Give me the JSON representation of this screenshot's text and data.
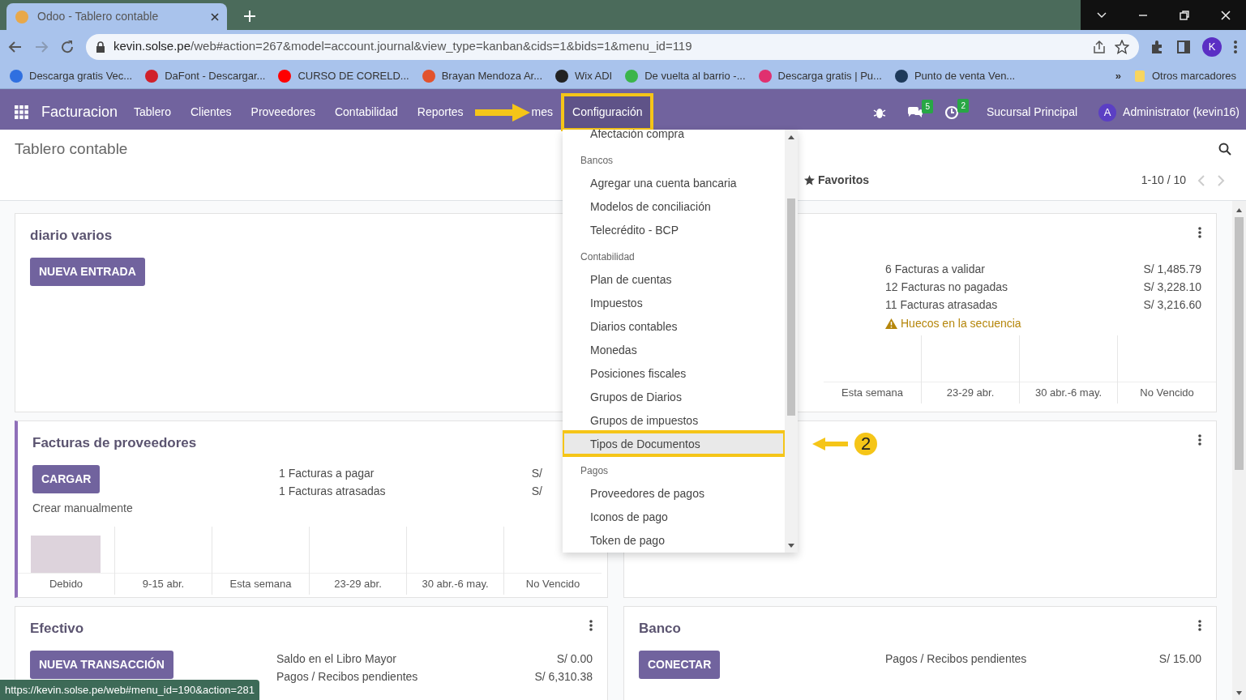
{
  "browser": {
    "tab_title": "Odoo - Tablero contable",
    "url_host": "kevin.solse.pe",
    "url_path": "/web#action=267&model=account.journal&view_type=kanban&cids=1&bids=1&menu_id=119",
    "profile_initial": "K",
    "bookmarks": [
      {
        "label": "Descarga gratis Vec...",
        "color": "#2f6fe0"
      },
      {
        "label": "DaFont - Descargar...",
        "color": "#d0202a"
      },
      {
        "label": "CURSO DE CORELD...",
        "color": "#ff0000"
      },
      {
        "label": "Brayan Mendoza Ar...",
        "color": "#e2532d"
      },
      {
        "label": "Wix ADI",
        "color": "#222222"
      },
      {
        "label": "De vuelta al barrio -...",
        "color": "#3bb54a"
      },
      {
        "label": "Descarga gratis | Pu...",
        "color": "#e0306f"
      },
      {
        "label": "Punto de venta Ven...",
        "color": "#1e3a5a"
      }
    ],
    "more": "»",
    "other_bookmarks": "Otros marcadores",
    "status_url": "https://kevin.solse.pe/web#menu_id=190&action=281"
  },
  "app": {
    "name": "Facturacion",
    "menu": [
      {
        "label": "Tablero",
        "selected": false,
        "outlined": false
      },
      {
        "label": "Clientes",
        "selected": false,
        "outlined": false
      },
      {
        "label": "Proveedores",
        "selected": false,
        "outlined": false
      },
      {
        "label": "Contabilidad",
        "selected": false,
        "outlined": false
      },
      {
        "label": "Reportes",
        "selected": false,
        "outlined": false
      },
      {
        "label": "mes",
        "selected": false,
        "outlined": false
      },
      {
        "label": "Configuración",
        "selected": true,
        "outlined": true
      }
    ],
    "messages_badge": "5",
    "activities_badge": "2",
    "company": "Sucursal Principal",
    "user_initial": "A",
    "user": "Administrator (kevin16)"
  },
  "dropdown": [
    {
      "kind": "item",
      "label": "Afectación compra",
      "selected": false,
      "outlined": false
    },
    {
      "kind": "header",
      "label": "Bancos"
    },
    {
      "kind": "item",
      "label": "Agregar una cuenta bancaria",
      "selected": false,
      "outlined": false
    },
    {
      "kind": "item",
      "label": "Modelos de conciliación",
      "selected": false,
      "outlined": false
    },
    {
      "kind": "item",
      "label": "Telecrédito - BCP",
      "selected": false,
      "outlined": false
    },
    {
      "kind": "header",
      "label": "Contabilidad"
    },
    {
      "kind": "item",
      "label": "Plan de cuentas",
      "selected": false,
      "outlined": false
    },
    {
      "kind": "item",
      "label": "Impuestos",
      "selected": false,
      "outlined": false
    },
    {
      "kind": "item",
      "label": "Diarios contables",
      "selected": false,
      "outlined": false
    },
    {
      "kind": "item",
      "label": "Monedas",
      "selected": false,
      "outlined": false
    },
    {
      "kind": "item",
      "label": "Posiciones fiscales",
      "selected": false,
      "outlined": false
    },
    {
      "kind": "item",
      "label": "Grupos de Diarios",
      "selected": false,
      "outlined": false
    },
    {
      "kind": "item",
      "label": "Grupos de impuestos",
      "selected": false,
      "outlined": false
    },
    {
      "kind": "item",
      "label": "Tipos de Documentos",
      "selected": true,
      "outlined": true
    },
    {
      "kind": "header",
      "label": "Pagos"
    },
    {
      "kind": "item",
      "label": "Proveedores de pagos",
      "selected": false,
      "outlined": false
    },
    {
      "kind": "item",
      "label": "Iconos de pago",
      "selected": false,
      "outlined": false
    },
    {
      "kind": "item",
      "label": "Token de pago",
      "selected": false,
      "outlined": false
    }
  ],
  "step_number": "2",
  "control_panel": {
    "title": "Tablero contable",
    "favorites": "Favoritos",
    "pager": "1-10 / 10"
  },
  "cards": [
    {
      "title": "diario varios",
      "button": "NUEVA ENTRADA",
      "accent": false,
      "menu": false
    },
    {
      "accent": false,
      "menu": true,
      "stats": [
        {
          "label": "6 Facturas a validar",
          "amount": "S/ 1,485.79",
          "kind": "plain"
        },
        {
          "label": "12 Facturas no pagadas",
          "amount": "S/ 3,228.10",
          "kind": "plain"
        },
        {
          "label": "11 Facturas atrasadas",
          "amount": "S/ 3,216.60",
          "kind": "plain"
        },
        {
          "label": "Huecos en la secuencia",
          "kind": "warning"
        }
      ],
      "chart_labels": [
        "Esta semana",
        "23-29 abr.",
        "30 abr.-6 may.",
        "No Vencido"
      ]
    },
    {
      "title": "Facturas de proveedores",
      "button": "CARGAR",
      "link": "Crear manualmente",
      "accent": true,
      "menu": false,
      "stats": [
        {
          "label": "1 Facturas a pagar",
          "amount": "S/",
          "kind": "plain"
        },
        {
          "label": "1 Facturas atrasadas",
          "amount": "S/",
          "kind": "plain"
        }
      ],
      "chart_labels": [
        "Debido",
        "9-15 abr.",
        "Esta semana",
        "23-29 abr.",
        "30 abr.-6 may.",
        "No Vencido"
      ]
    },
    {
      "accent": false,
      "menu": true
    },
    {
      "title": "Efectivo",
      "button": "NUEVA TRANSACCIÓN",
      "accent": false,
      "menu": true,
      "stats": [
        {
          "label": "Saldo en el Libro Mayor",
          "amount": "S/ 0.00",
          "kind": "plain"
        },
        {
          "label": "Pagos / Recibos pendientes",
          "amount": "S/ 6,310.38",
          "kind": "plain"
        }
      ]
    },
    {
      "title": "Banco",
      "button": "CONECTAR",
      "accent": false,
      "menu": true,
      "stats": [
        {
          "label": "Pagos / Recibos pendientes",
          "amount": "S/ 15.00",
          "kind": "plain"
        }
      ]
    }
  ]
}
